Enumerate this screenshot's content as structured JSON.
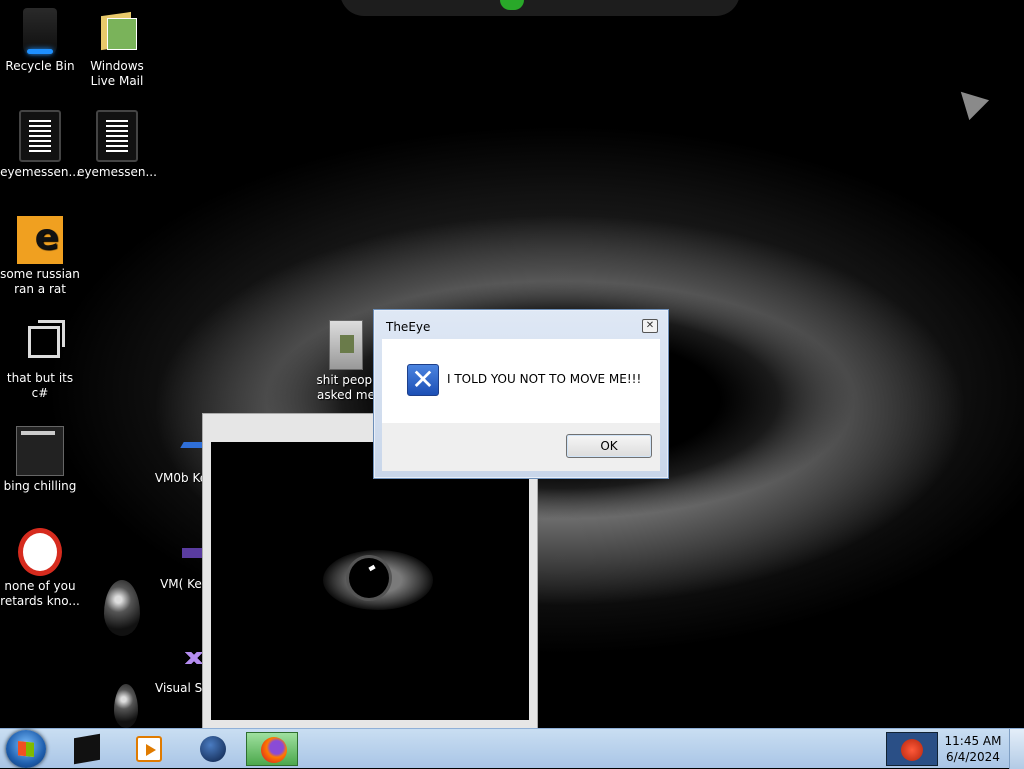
{
  "desktop": {
    "icons": [
      {
        "label": "Recycle Bin",
        "icon": "recycle-bin-icon"
      },
      {
        "label": "Windows Live Mail",
        "icon": "windows-live-mail-icon"
      },
      {
        "label": "eyemessen...",
        "icon": "text-document-icon"
      },
      {
        "label": "eyemessen...",
        "icon": "text-document-icon"
      },
      {
        "label": "some russian ran a rat",
        "icon": "application-icon"
      },
      {
        "label": "that but its c#",
        "icon": "copy-icon"
      },
      {
        "label": "bing chilling",
        "icon": "window-icon"
      },
      {
        "label": "none of you retards kno...",
        "icon": "ring-icon"
      },
      {
        "label": "shit peopl asked me",
        "icon": "folder-icon"
      },
      {
        "label": "VM0b Kevin:",
        "icon": "vm-icon"
      },
      {
        "label": "VM( Kevin:",
        "icon": "vm-icon"
      },
      {
        "label": "Visual S 201",
        "icon": "visual-studio-icon"
      }
    ]
  },
  "dialog": {
    "title": "TheEye",
    "message": "I TOLD YOU NOT TO MOVE ME!!!",
    "ok_label": "OK",
    "close_glyph": "✕",
    "icon": "error-x-icon",
    "icon_glyph": "✕"
  },
  "taskbar": {
    "items": [
      {
        "name": "terminal-icon"
      },
      {
        "name": "media-player-icon"
      },
      {
        "name": "globe-icon"
      },
      {
        "name": "firefox-icon",
        "active": true
      }
    ],
    "clock": {
      "time": "11:45 AM",
      "date": "6/4/2024"
    }
  },
  "colors": {
    "accent": "#1c4fb5",
    "taskbar": "#b9d1ec",
    "active_item": "#4ca84c"
  }
}
